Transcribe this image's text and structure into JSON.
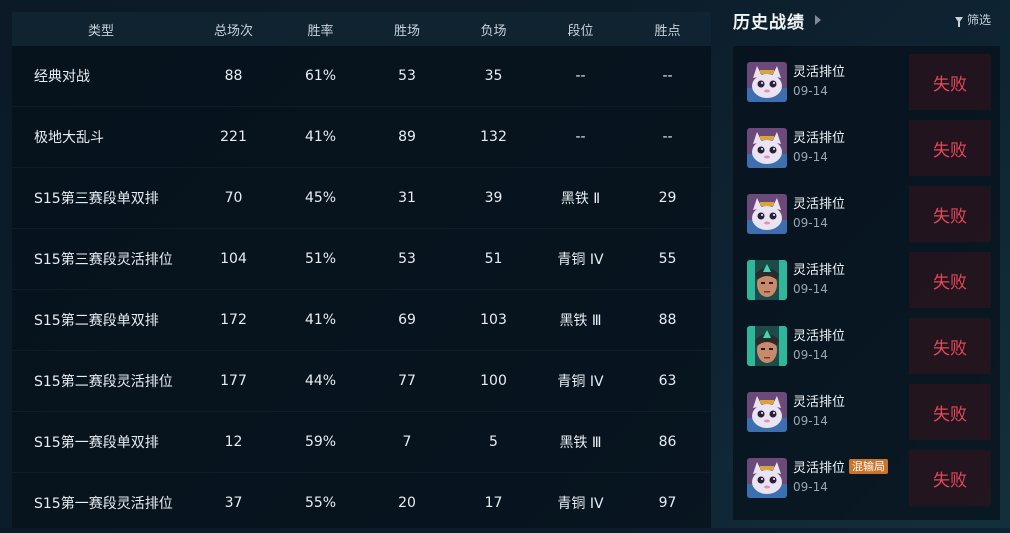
{
  "stats_table": {
    "headers": {
      "type": "类型",
      "total": "总场次",
      "win_rate": "胜率",
      "wins": "胜场",
      "losses": "负场",
      "tier": "段位",
      "points": "胜点"
    },
    "rows": [
      {
        "type": "经典对战",
        "total": "88",
        "win_rate": "61%",
        "wins": "53",
        "losses": "35",
        "tier": "--",
        "points": "--"
      },
      {
        "type": "极地大乱斗",
        "total": "221",
        "win_rate": "41%",
        "wins": "89",
        "losses": "132",
        "tier": "--",
        "points": "--"
      },
      {
        "type": "S15第三赛段单双排",
        "total": "70",
        "win_rate": "45%",
        "wins": "31",
        "losses": "39",
        "tier": "黑铁 Ⅱ",
        "points": "29"
      },
      {
        "type": "S15第三赛段灵活排位",
        "total": "104",
        "win_rate": "51%",
        "wins": "53",
        "losses": "51",
        "tier": "青铜 IV",
        "points": "55"
      },
      {
        "type": "S15第二赛段单双排",
        "total": "172",
        "win_rate": "41%",
        "wins": "69",
        "losses": "103",
        "tier": "黑铁 Ⅲ",
        "points": "88"
      },
      {
        "type": "S15第二赛段灵活排位",
        "total": "177",
        "win_rate": "44%",
        "wins": "77",
        "losses": "100",
        "tier": "青铜 IV",
        "points": "63"
      },
      {
        "type": "S15第一赛段单双排",
        "total": "12",
        "win_rate": "59%",
        "wins": "7",
        "losses": "5",
        "tier": "黑铁 Ⅲ",
        "points": "86"
      },
      {
        "type": "S15第一赛段灵活排位",
        "total": "37",
        "win_rate": "55%",
        "wins": "20",
        "losses": "17",
        "tier": "青铜 IV",
        "points": "97"
      }
    ]
  },
  "history": {
    "title": "历史战绩",
    "filter_label": "筛选",
    "matches": [
      {
        "mode": "灵活排位",
        "date": "09-14",
        "result": "失败",
        "champion_icon": "cat-champion-avatar",
        "tag": ""
      },
      {
        "mode": "灵活排位",
        "date": "09-14",
        "result": "失败",
        "champion_icon": "cat-champion-avatar",
        "tag": ""
      },
      {
        "mode": "灵活排位",
        "date": "09-14",
        "result": "失败",
        "champion_icon": "cat-champion-avatar",
        "tag": ""
      },
      {
        "mode": "灵活排位",
        "date": "09-14",
        "result": "失败",
        "champion_icon": "archer-champion-avatar",
        "tag": ""
      },
      {
        "mode": "灵活排位",
        "date": "09-14",
        "result": "失败",
        "champion_icon": "archer-champion-avatar",
        "tag": ""
      },
      {
        "mode": "灵活排位",
        "date": "09-14",
        "result": "失败",
        "champion_icon": "cat-champion-avatar",
        "tag": ""
      },
      {
        "mode": "灵活排位",
        "date": "09-14",
        "result": "失败",
        "champion_icon": "cat-champion-avatar",
        "tag": "混输局"
      }
    ]
  },
  "colors": {
    "loss_text": "#e5485a",
    "tag_bg": "#c9742a"
  }
}
